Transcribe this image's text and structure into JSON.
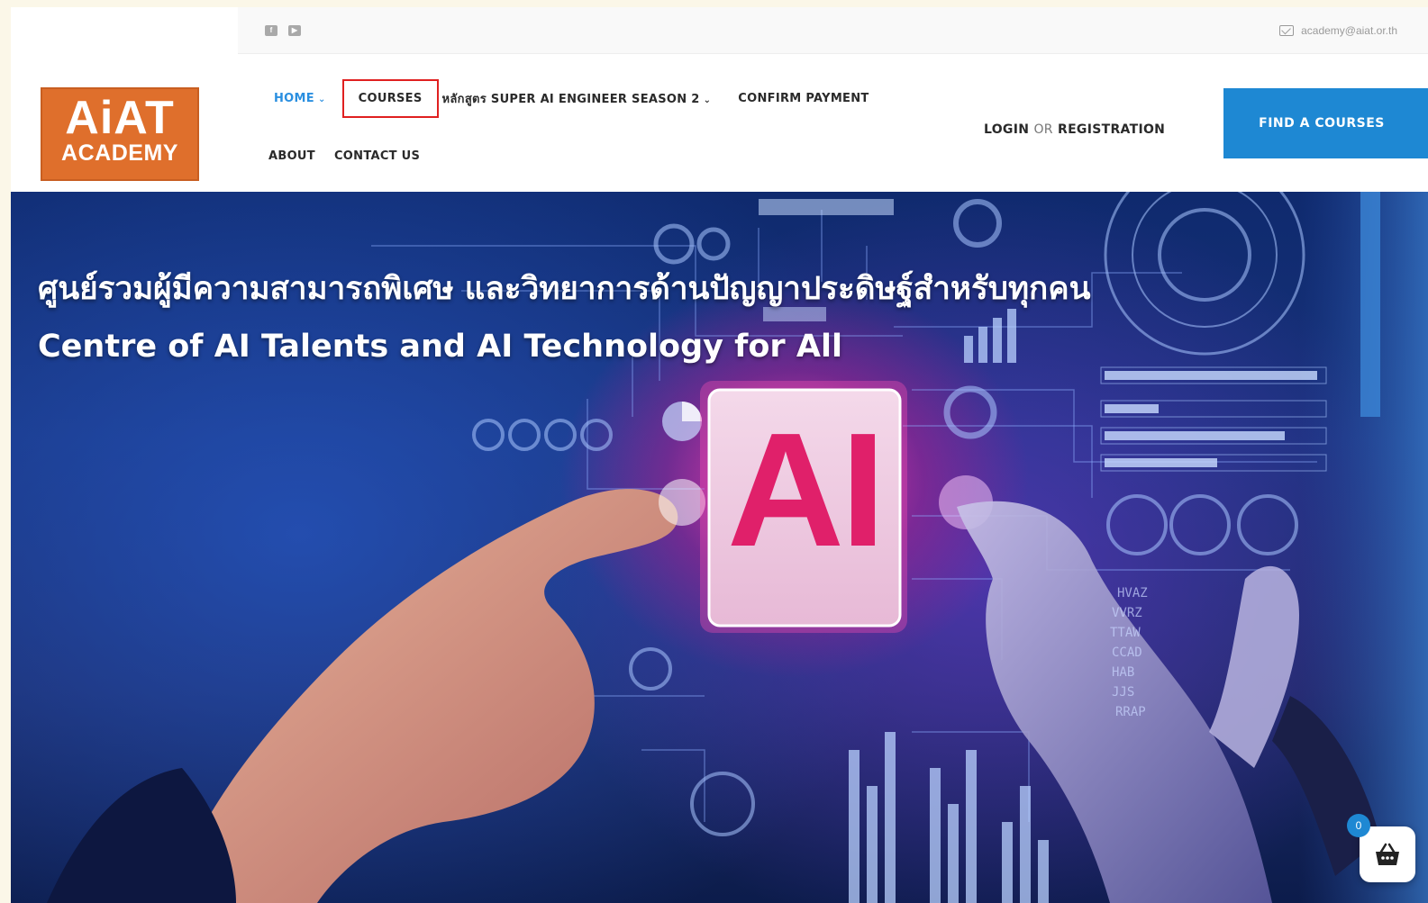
{
  "topbar": {
    "social": [
      {
        "icon": "facebook-icon",
        "glyph": "f"
      },
      {
        "icon": "youtube-icon",
        "glyph": "▶"
      }
    ],
    "email": "academy@aiat.or.th"
  },
  "logo": {
    "line1": "AiAT",
    "line2": "ACADEMY",
    "color": "#df6f2c"
  },
  "nav": {
    "home": "HOME",
    "courses": "COURSES",
    "super_ai": "หลักสูตร SUPER AI ENGINEER SEASON 2",
    "confirm_payment": "CONFIRM PAYMENT",
    "about": "ABOUT",
    "contact": "CONTACT US",
    "login": "LOGIN",
    "or": "OR",
    "registration": "REGISTRATION",
    "find_courses": "FIND A COURSES"
  },
  "hero": {
    "title_th": "ศูนย์รวมผู้มีความสามารถพิเศษ และวิทยาการด้านปัญญาประดิษฐ์สำหรับทุกคน",
    "title_en": "Centre of AI Talents and AI Technology for All",
    "chip_text": "AI",
    "side_codes": [
      "HVAZ",
      "VVRZ",
      "TTAW",
      "CCAD",
      "HAB",
      "JJS",
      "RRAP"
    ]
  },
  "cart": {
    "count": "0"
  },
  "colors": {
    "accent": "#1e88d3",
    "highlight": "#e02020",
    "brand": "#df6f2c"
  }
}
